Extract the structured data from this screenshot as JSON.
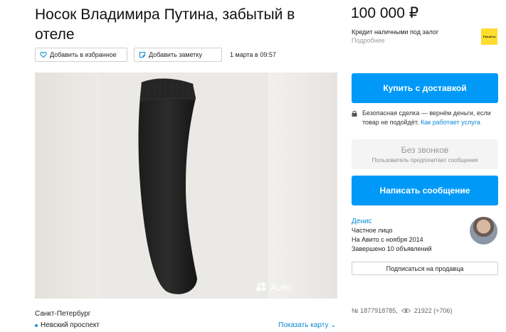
{
  "listing": {
    "title": "Носок Владимира Путина, забытый в отеле",
    "price": "100 000 ₽",
    "date": "1 марта в 09:57",
    "city": "Санкт-Петербург",
    "metro": "Невский проспект",
    "show_map": "Показать карту",
    "number": "№ 1877918785,",
    "views": "21922 (+706)"
  },
  "actions": {
    "favorite_label": "Добавить в избранное",
    "note_label": "Добавить заметку"
  },
  "photo": {
    "watermark": "Avito"
  },
  "credit": {
    "text": "Кредит наличными под залог",
    "more": "Подробнее",
    "logo_text": "Tinkoff.ru"
  },
  "buy": {
    "label": "Купить с доставкой",
    "safe_text": "Безопасная сделка — вернём деньги, если товар не подойдёт.",
    "safe_link": "Как работает услуга"
  },
  "no_calls": {
    "label": "Без звонков",
    "sub": "Пользователь предпочитает сообщения"
  },
  "message": {
    "label": "Написать сообщение"
  },
  "seller": {
    "name": "Денис",
    "type": "Частное лицо",
    "since": "На Авито с ноября 2014",
    "completed": "Завершено 10 объявлений",
    "subscribe_label": "Подписаться на продавца"
  },
  "colors": {
    "accent": "#0099f7",
    "link": "#0a8ad6",
    "logo": "#ffdd2d"
  }
}
